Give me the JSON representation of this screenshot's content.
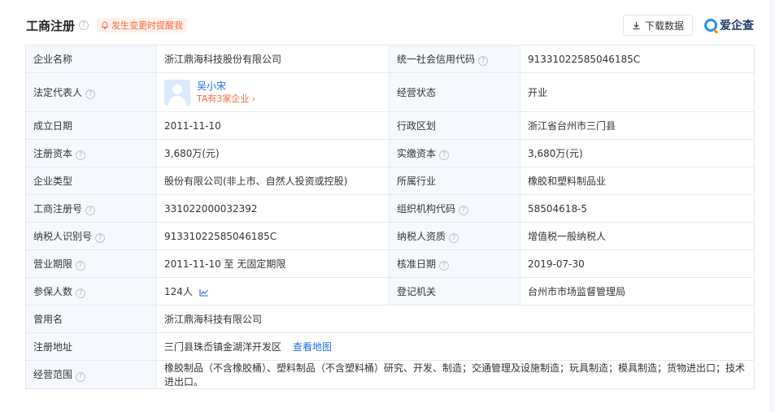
{
  "header": {
    "title": "工商注册",
    "remind_label": "发生变更时提醒我",
    "download_label": "下载数据",
    "logo_text": "爱企查"
  },
  "colors": {
    "link_blue": "#1e6fe6",
    "accent_orange": "#f56a3c",
    "label_bg": "#f5f8fc",
    "border": "#e6e9ee"
  },
  "rows": [
    {
      "l1": "企业名称",
      "v1": "浙江鼎海科技股份有限公司",
      "l2": "统一社会信用代码",
      "v2": "91331022585046185C"
    },
    {
      "l1": "法定代表人",
      "rep_name": "吴小宋",
      "rep_link": "TA有3家企业",
      "l2": "经营状态",
      "v2": "开业"
    },
    {
      "l1": "成立日期",
      "v1": "2011-11-10",
      "l2": "行政区划",
      "v2": "浙江省台州市三门县"
    },
    {
      "l1": "注册资本",
      "v1": "3,680万(元)",
      "l2": "实缴资本",
      "v2": "3,680万(元)"
    },
    {
      "l1": "企业类型",
      "v1": "股份有限公司(非上市、自然人投资或控股)",
      "l2": "所属行业",
      "v2": "橡胶和塑料制品业"
    },
    {
      "l1": "工商注册号",
      "v1": "331022000032392",
      "l2": "组织机构代码",
      "v2": "58504618-5"
    },
    {
      "l1": "纳税人识别号",
      "v1": "91331022585046185C",
      "l2": "纳税人资质",
      "v2": "增值税一般纳税人"
    },
    {
      "l1": "营业期限",
      "v1": "2011-11-10 至 无固定期限",
      "l2": "核准日期",
      "v2": "2019-07-30"
    },
    {
      "l1": "参保人数",
      "v1": "124人",
      "l2": "登记机关",
      "v2": "台州市市场监督管理局"
    },
    {
      "l1": "曾用名",
      "v1": "浙江鼎海科技有限公司"
    },
    {
      "l1": "注册地址",
      "v1": "三门县珠岙镇金湖洋开发区",
      "map_link": "查看地图"
    },
    {
      "l1": "经营范围",
      "v1": "橡胶制品（不含橡胶桶）、塑料制品（不含塑料桶）研究、开发、制造；交通管理及设施制造；玩具制造；模具制造；货物进出口；技术进出口。"
    }
  ]
}
